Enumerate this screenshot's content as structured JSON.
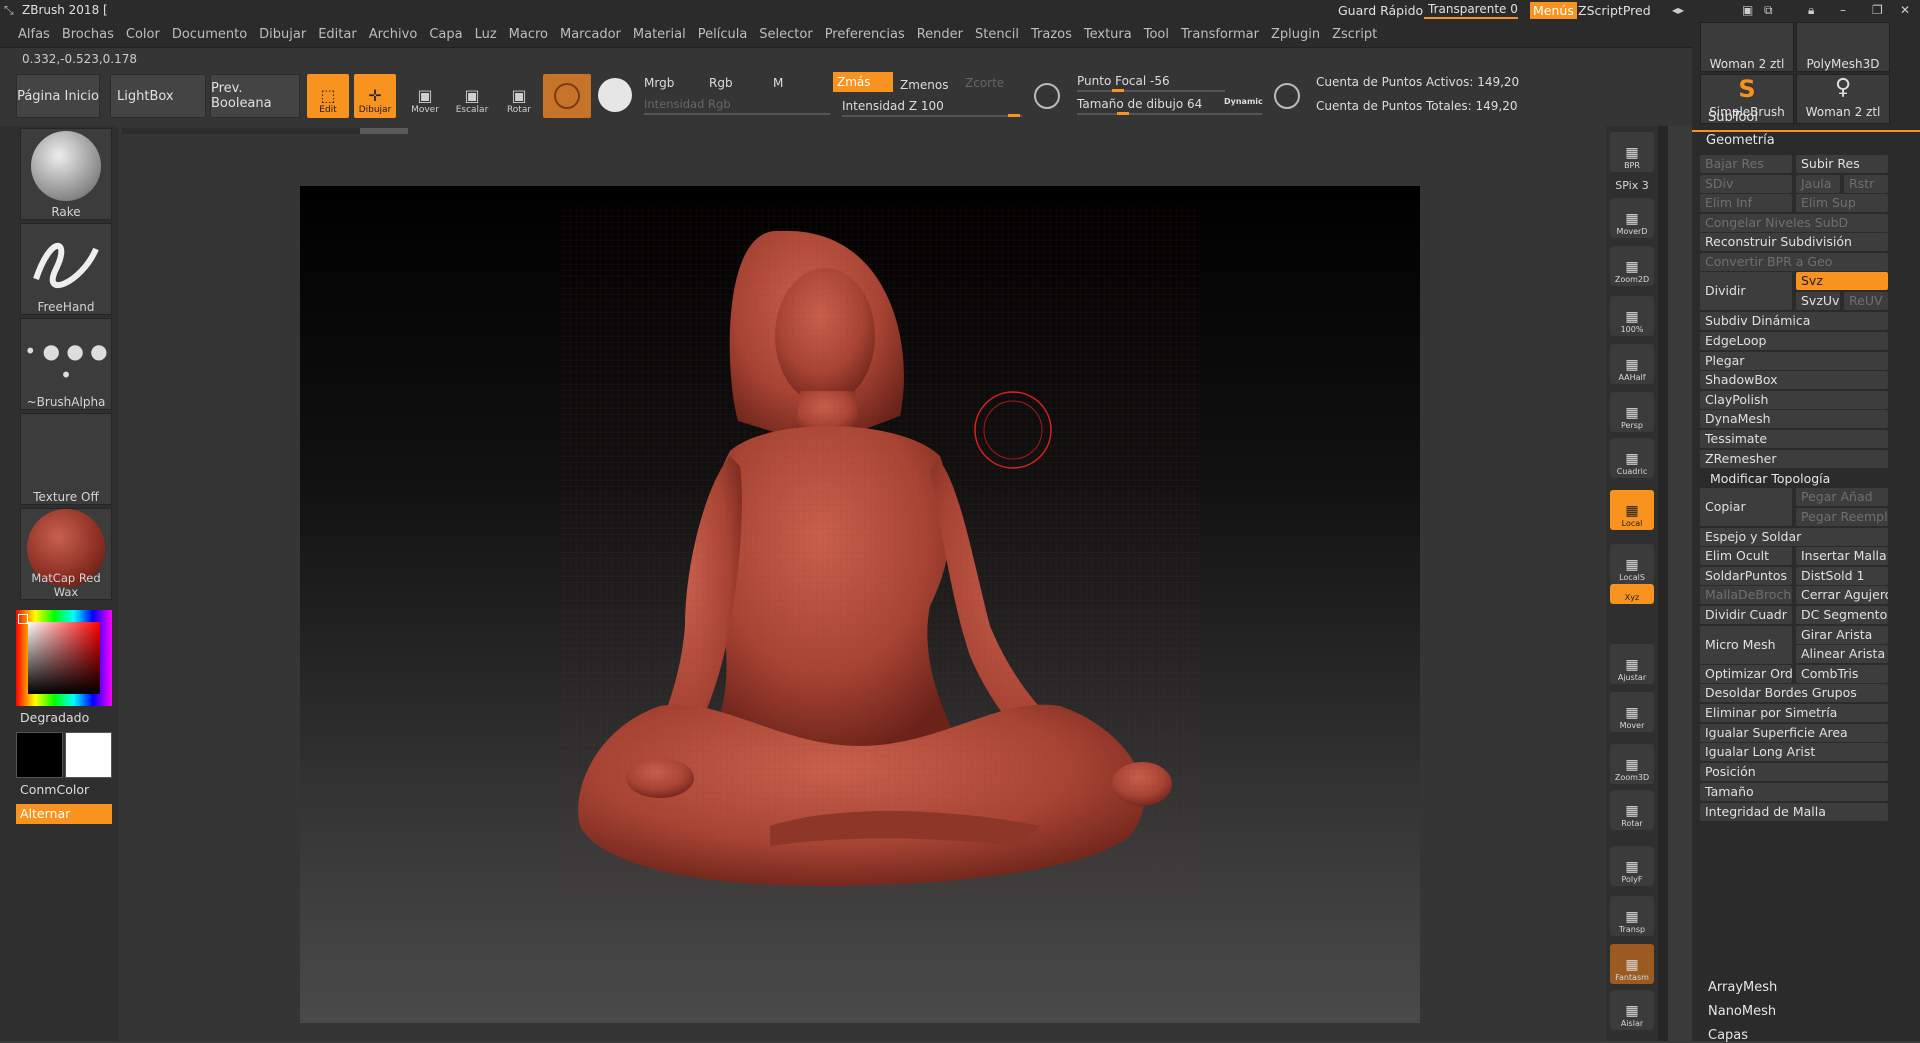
{
  "title": {
    "app": "ZBrush 2018 [",
    "quick_save": "Guard Rápido",
    "transparent": "Transparente 0",
    "menus": "Menús",
    "zscript_pred": "ZScriptPred"
  },
  "menu": [
    "Alfas",
    "Brochas",
    "Color",
    "Documento",
    "Dibujar",
    "Editar",
    "Archivo",
    "Capa",
    "Luz",
    "Macro",
    "Marcador",
    "Material",
    "Película",
    "Selector",
    "Preferencias",
    "Render",
    "Stencil",
    "Trazos",
    "Textura",
    "Tool",
    "Transformar",
    "Zplugin",
    "Zscript"
  ],
  "coords": "0.332,-0.523,0.178",
  "toolbar": {
    "home": "Página Inicio",
    "lightbox": "LightBox",
    "boolean": "Prev. Booleana",
    "edit": "Edit",
    "draw": "Dibujar",
    "move": "Mover",
    "scale": "Escalar",
    "rotate": "Rotar",
    "mrgb": "Mrgb",
    "rgb": "Rgb",
    "m": "M",
    "rgb_intensity": "Intensidad Rgb",
    "zadd": "Zmás",
    "zsub": "Zmenos",
    "zcut": "Zcorte",
    "z_intensity": "Intensidad Z 100",
    "focal": "Punto Focal -56",
    "draw_size": "Tamaño de dibujo 64",
    "dynamic": "Dynamic",
    "active_points": "Cuenta de Puntos Activos: 149,20",
    "total_points": "Cuenta de Puntos Totales: 149,20"
  },
  "left": {
    "brush": "Rake",
    "stroke": "FreeHand",
    "alpha": "~BrushAlpha",
    "texture": "Texture Off",
    "material": "MatCap Red Wax",
    "gradient": "Degradado",
    "conmcolor": "ConmColor",
    "alternate": "Alternar"
  },
  "right_shelf": [
    "BPR",
    "SPix 3",
    "MoverD",
    "Zoom2D",
    "100%",
    "AAHalf",
    "Persp",
    "Cuadric",
    "Local",
    "LocalS",
    "Xyz",
    "Ajustar",
    "Mover",
    "Zoom3D",
    "Rotar",
    "PolyF",
    "Transp",
    "Fantasm",
    "Aislar"
  ],
  "palette": {
    "tools": [
      {
        "label": "Woman 2 ztl"
      },
      {
        "label": "PolyMesh3D"
      },
      {
        "label": "SimpleBrush"
      },
      {
        "label": "Woman 2 ztl"
      }
    ],
    "subtool": "SubTool",
    "geometry": "Geometría",
    "rows": {
      "lower_res": "Bajar Res",
      "higher_res": "Subir Res",
      "sdiv": "SDiv",
      "cage": "Jaula",
      "rstr": "Rstr",
      "del_lower": "Elim Inf",
      "del_higher": "Elim Sup",
      "freeze": "Congelar Niveles SubD",
      "reconstruct": "Reconstruir Subdivisión",
      "convert_bpr": "Convertir BPR a Geo",
      "divide": "Dividir",
      "svz": "Svz",
      "svzuv": "SvzUv",
      "reuv": "ReUV",
      "dynamic_subdiv": "Subdiv Dinámica",
      "edgeloop": "EdgeLoop",
      "crease": "Plegar",
      "shadowbox": "ShadowBox",
      "claypolish": "ClayPolish",
      "dynamesh": "DynaMesh",
      "tessimate": "Tessimate",
      "zremesher": "ZRemesher",
      "modify_topology": "Modificar Topología",
      "copy": "Copiar",
      "paste_append": "Pegar Añad",
      "paste_replace": "Pegar Reempl",
      "mirror_weld": "Espejo y Soldar",
      "del_hidden": "Elim Ocult",
      "insert_mesh": "Insertar Malla",
      "weld_points": "SoldarPuntos",
      "dist_weld": "DistSold 1",
      "mesh_brush": "MallaDeBroch",
      "close_holes": "Cerrar Agujeros",
      "divide_quads": "Dividir Cuadr",
      "dc_segments": "DC Segmentos",
      "micro_mesh": "Micro Mesh",
      "spin_edge": "Girar Arista",
      "align_edge": "Alinear Arista",
      "optimize_order": "Optimizar Orden",
      "combtris": "CombTris",
      "unweld_groups": "Desoldar Bordes Grupos",
      "delete_symmetry": "Eliminar por Simetría",
      "equalize_surface": "Igualar Superficie Area",
      "equalize_edge": "Igualar Long Arist",
      "position": "Posición",
      "size": "Tamaño",
      "integrity": "Integridad de Malla"
    },
    "arraymesh": "ArrayMesh",
    "nanomesh": "NanoMesh",
    "layers": "Capas"
  },
  "colors": {
    "accent": "#f7931e",
    "model": "#b04a3c",
    "panel": "#2b2b2b"
  }
}
